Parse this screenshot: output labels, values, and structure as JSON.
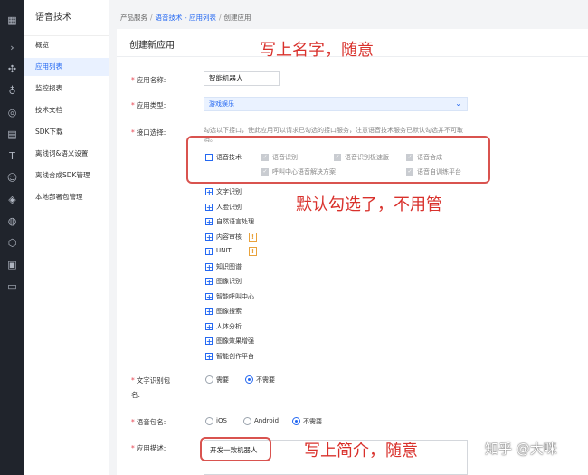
{
  "rail_icons": [
    "grid-icon",
    "chevron-right-icon",
    "node-icon",
    "mic-icon",
    "globe-icon",
    "document-icon",
    "text-icon",
    "face-icon",
    "tag-icon",
    "car-icon",
    "hexagon-icon",
    "image-icon",
    "box-icon"
  ],
  "sidebar": {
    "title": "语音技术",
    "items": [
      {
        "label": "概览"
      },
      {
        "label": "应用列表",
        "active": true
      },
      {
        "label": "监控报表"
      },
      {
        "label": "技术文档"
      },
      {
        "label": "SDK下载"
      },
      {
        "label": "离线词&语义设置"
      },
      {
        "label": "离线合成SDK管理"
      },
      {
        "label": "本地部署包管理"
      }
    ]
  },
  "breadcrumb": {
    "root": "产品服务",
    "link": "语音技术 - 应用列表",
    "current": "创建应用"
  },
  "page_title": "创建新应用",
  "form": {
    "name_label": "应用名称:",
    "name_value": "智能机器人",
    "type_label": "应用类型:",
    "type_value": "游戏娱乐",
    "api_label": "接口选择:",
    "api_hint": "勾选以下接口，使此应用可以请求已勾选的接口服务，注意语音技术服务已默认勾选并不可取消。",
    "speech_group": "语音技术",
    "speech_options": [
      "语音识别",
      "语音识别极速版",
      "语音合成",
      "呼叫中心语音解决方案",
      "语音自训练平台"
    ],
    "groups": [
      "文字识别",
      "人脸识别",
      "自然语言处理",
      "内容审核",
      "UNIT",
      "知识图谱",
      "图像识别",
      "智能呼叫中心",
      "图像搜索",
      "人体分析",
      "图像效果增强",
      "智能创作平台"
    ],
    "warn_groups": [
      3,
      4
    ],
    "ocr_pkg_label": "文字识别包名:",
    "ocr_options": [
      "需要",
      "不需要"
    ],
    "ocr_selected": 1,
    "voice_pkg_label": "语音包名:",
    "voice_options": [
      "iOS",
      "Android",
      "不需要"
    ],
    "voice_selected": 2,
    "desc_label": "应用描述:",
    "desc_value": "开发一款机器人"
  },
  "annotations": {
    "name_note": "写上名字，随意",
    "default_note": "默认勾选了，不用管",
    "desc_note": "写上简介，随意"
  },
  "watermark": "知乎 @大咪",
  "colors": {
    "accent": "#2468f2",
    "annotation": "#d9312c",
    "rail": "#20242c"
  }
}
